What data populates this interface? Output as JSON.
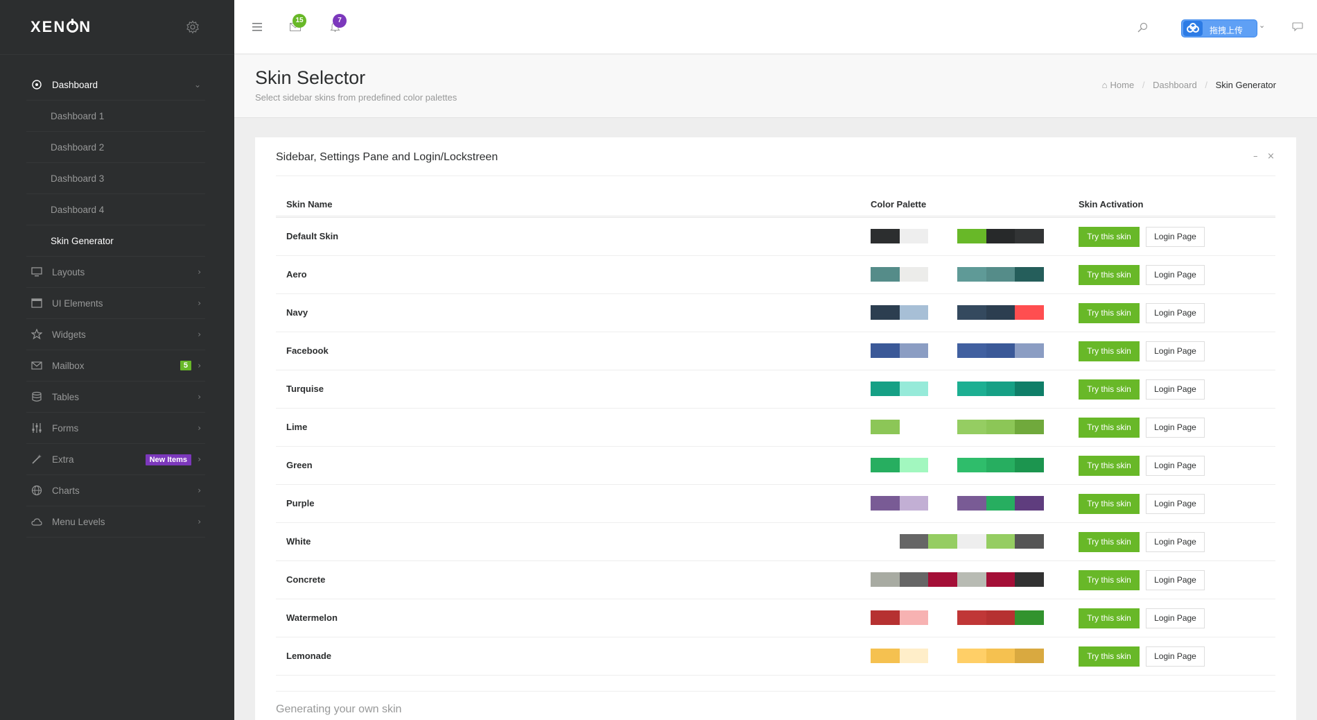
{
  "app": {
    "logo_text_left": "XEN",
    "logo_text_right": "N"
  },
  "sidebar": {
    "items": [
      {
        "label": "Dashboard",
        "icon": "dashboard-icon",
        "active": true
      },
      {
        "label": "Dashboard 1",
        "sub": true
      },
      {
        "label": "Dashboard 2",
        "sub": true
      },
      {
        "label": "Dashboard 3",
        "sub": true
      },
      {
        "label": "Dashboard 4",
        "sub": true
      },
      {
        "label": "Skin Generator",
        "sub": true,
        "current": true
      },
      {
        "label": "Layouts",
        "icon": "monitor-icon"
      },
      {
        "label": "UI Elements",
        "icon": "window-icon"
      },
      {
        "label": "Widgets",
        "icon": "star-icon"
      },
      {
        "label": "Mailbox",
        "icon": "envelope-icon",
        "badge": "5"
      },
      {
        "label": "Tables",
        "icon": "database-icon"
      },
      {
        "label": "Forms",
        "icon": "sliders-icon"
      },
      {
        "label": "Extra",
        "icon": "magic-icon",
        "badge": "New Items"
      },
      {
        "label": "Charts",
        "icon": "globe-icon"
      },
      {
        "label": "Menu Levels",
        "icon": "cloud-icon"
      }
    ]
  },
  "topbar": {
    "messages_count": "15",
    "notifications_count": "7",
    "upload_label": "拖拽上传"
  },
  "page": {
    "title": "Skin Selector",
    "description": "Select sidebar skins from predefined color palettes",
    "breadcrumb": {
      "home": "Home",
      "dashboard": "Dashboard",
      "current": "Skin Generator"
    }
  },
  "panel": {
    "title": "Sidebar, Settings Pane and Login/Lockstreen",
    "minimize": "–",
    "close": "×",
    "columns": {
      "name": "Skin Name",
      "palette": "Color Palette",
      "activation": "Skin Activation"
    },
    "try_label": "Try this skin",
    "login_label": "Login Page",
    "footer_title": "Generating your own skin"
  },
  "colors": {
    "accent_green": "#68b828",
    "accent_purple": "#7c38bc",
    "sidebar_bg": "#2c2e2f"
  },
  "skins": [
    {
      "name": "Default Skin",
      "palette": [
        "#2c2e2f",
        "#eeeeee",
        "#ffffff",
        "#68b828",
        "#27292a",
        "#323435"
      ]
    },
    {
      "name": "Aero",
      "palette": [
        "#558c89",
        "#ececea",
        "#ffffff",
        "#5f9a97",
        "#558c89",
        "#255e5b"
      ]
    },
    {
      "name": "Navy",
      "palette": [
        "#2c3e50",
        "#a7bfd6",
        "#ffffff",
        "#34495e",
        "#2c3e50",
        "#ff4e50"
      ]
    },
    {
      "name": "Facebook",
      "palette": [
        "#3b5998",
        "#8b9dc3",
        "#ffffff",
        "#4160a0",
        "#3b5998",
        "#8b9dc3"
      ]
    },
    {
      "name": "Turquise",
      "palette": [
        "#16a085",
        "#96ead9",
        "#ffffff",
        "#1daf92",
        "#16a085",
        "#0f7e68"
      ]
    },
    {
      "name": "Lime",
      "palette": [
        "#8cc657",
        "#ffffff",
        "#ffffff",
        "#95cd62",
        "#8cc657",
        "#70a93c"
      ]
    },
    {
      "name": "Green",
      "palette": [
        "#27ae60",
        "#a2f7bf",
        "#ffffff",
        "#2fbd6b",
        "#27ae60",
        "#1c954f"
      ]
    },
    {
      "name": "Purple",
      "palette": [
        "#795b95",
        "#c2afd4",
        "#ffffff",
        "#795b95",
        "#27ae60",
        "#5f3d7e"
      ]
    },
    {
      "name": "White",
      "palette": [
        "#ffffff",
        "#666666",
        "#95cd62",
        "#eeeeee",
        "#95cd62",
        "#555555"
      ]
    },
    {
      "name": "Concrete",
      "palette": [
        "#a8aba2",
        "#666666",
        "#a40f37",
        "#b8bbb3",
        "#a40f37",
        "#323232"
      ]
    },
    {
      "name": "Watermelon",
      "palette": [
        "#b63131",
        "#f7b2b2",
        "#ffffff",
        "#c03737",
        "#b63131",
        "#32932e"
      ]
    },
    {
      "name": "Lemonade",
      "palette": [
        "#f5c150",
        "#ffeec9",
        "#ffffff",
        "#ffcf67",
        "#f5c150",
        "#d9a940"
      ]
    }
  ]
}
